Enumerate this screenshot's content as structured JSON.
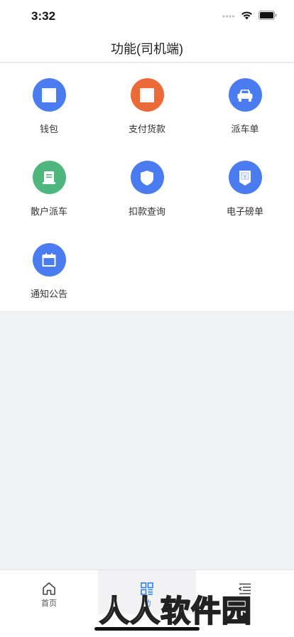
{
  "status_bar": {
    "time": "3:32"
  },
  "header": {
    "title": "功能(司机端)"
  },
  "functions": [
    {
      "label": "钱包",
      "icon": "wallet-icon",
      "color": "#4a7cf0"
    },
    {
      "label": "支付货款",
      "icon": "payment-icon",
      "color": "#ec6a37"
    },
    {
      "label": "派车单",
      "icon": "truck-icon",
      "color": "#4a7cf0"
    },
    {
      "label": "散户派车",
      "icon": "dispatch-doc-icon",
      "color": "#4fb67d"
    },
    {
      "label": "扣款查询",
      "icon": "shield-icon",
      "color": "#4a7cf0"
    },
    {
      "label": "电子磅单",
      "icon": "receipt-icon",
      "color": "#4a7cf0"
    },
    {
      "label": "通知公告",
      "icon": "calendar-icon",
      "color": "#4a7cf0"
    }
  ],
  "tabbar": {
    "tabs": [
      {
        "label": "首页",
        "icon": "home-icon",
        "active": false
      },
      {
        "label": "功",
        "icon": "grid-icon",
        "active": true
      },
      {
        "label": "",
        "icon": "menu-icon",
        "active": false
      }
    ],
    "active_color": "#2f80ed"
  },
  "watermark": {
    "text": "人人软件园"
  }
}
